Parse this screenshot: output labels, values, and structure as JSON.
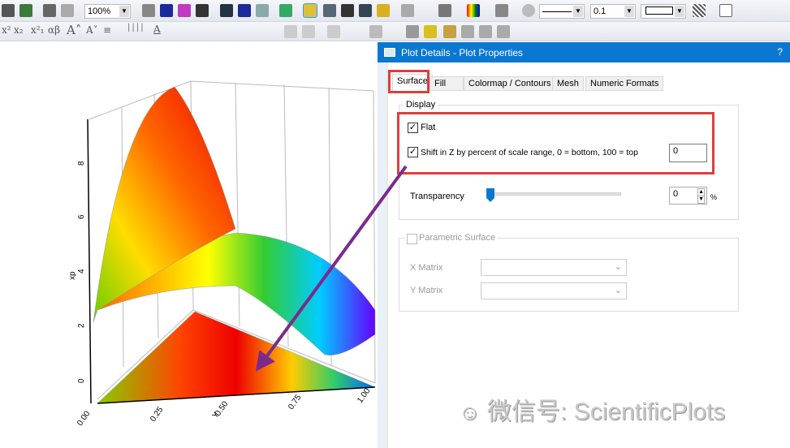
{
  "toolbar": {
    "zoom": "100%",
    "line_width": "0.1",
    "row2_symbols": [
      "x²",
      "x₂",
      "x²₁",
      "αβ",
      "A˄",
      "A˅",
      "≡",
      "││││",
      "A"
    ]
  },
  "plot": {
    "z_ticks": [
      "0",
      "2",
      "4",
      "6",
      "8"
    ],
    "z_label": "xp",
    "x_ticks": [
      "0.00",
      "0.25",
      "0.50",
      "0.75",
      "1.00"
    ],
    "x_label": "Y"
  },
  "dialog": {
    "title": "Plot Details - Plot Properties",
    "help": "?",
    "tabs": [
      "Surface",
      "Fill",
      "Colormap / Contours",
      "Mesh",
      "Numeric Formats"
    ],
    "display": {
      "legend": "Display",
      "flat_label": "Flat",
      "flat_checked": true,
      "shift_label": "Shift in Z by percent of scale range, 0 = bottom, 100 = top",
      "shift_checked": true,
      "shift_value": "0",
      "transparency_label": "Transparency",
      "transparency_value": "0",
      "transparency_unit": "%",
      "transparency_fraction": 0
    },
    "parametric": {
      "legend": "Parametric Surface",
      "checked": false,
      "x_label": "X Matrix",
      "y_label": "Y Matrix",
      "x_value": "",
      "y_value": ""
    }
  },
  "watermark": "微信号: ScientificPlots",
  "colors": {
    "title_bar": "#0a78d2",
    "highlight": "#d9403f",
    "arrow": "#7b2a8c"
  }
}
